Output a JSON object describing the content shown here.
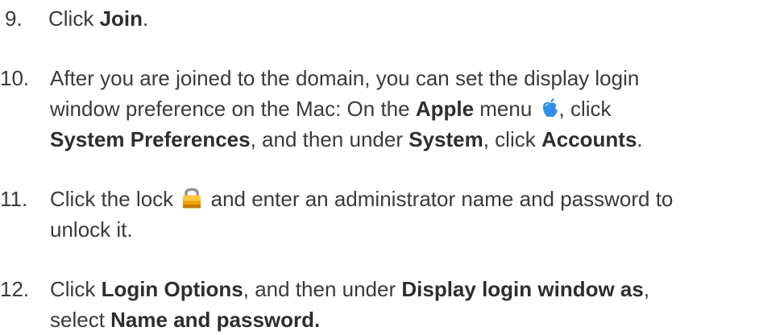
{
  "steps": [
    {
      "number": "9.",
      "lines": [
        {
          "pre": "Click ",
          "bold": "Join",
          "post": "."
        }
      ]
    },
    {
      "number": "10.",
      "line1": "After you are joined to the domain, you can set the display login",
      "line2_pre": "window preference on the Mac: On the ",
      "line2_bold": "Apple",
      "line2_mid": " menu ",
      "line2_post": ", click",
      "line3_bold1": "System Preferences",
      "line3_mid1": ", and then under ",
      "line3_bold2": "System",
      "line3_mid2": ", click ",
      "line3_bold3": "Accounts",
      "line3_post": "."
    },
    {
      "number": "11.",
      "line1_pre": "Click the lock ",
      "line1_post": " and enter an administrator name and password to",
      "line2": "unlock it."
    },
    {
      "number": "12.",
      "line1_pre": "Click ",
      "line1_bold1": "Login Options",
      "line1_mid": ", and then under ",
      "line1_bold2": "Display login window as",
      "line1_post": ",",
      "line2_pre": "select ",
      "line2_bold": "Name and password."
    }
  ],
  "icons": {
    "apple": "apple-icon",
    "lock": "lock-icon"
  },
  "colors": {
    "text": "#3a3a3a",
    "apple_blue": "#2f8fe8",
    "lock_orange": "#f0a000"
  }
}
